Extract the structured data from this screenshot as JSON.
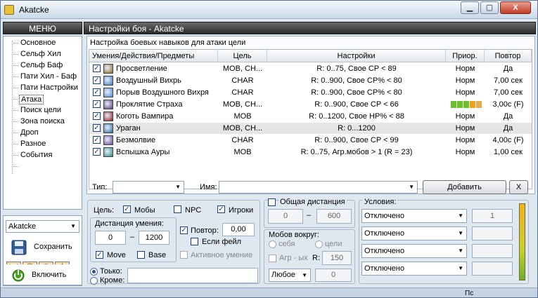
{
  "window": {
    "title": "Akatcke",
    "min_label": "▁",
    "max_label": "▢",
    "close_label": "X"
  },
  "menu": {
    "header": "МЕНЮ",
    "items": [
      "Основное",
      "Сельф Хил",
      "Сельф Баф",
      "Пати Хил - Баф",
      "Пати Настройки",
      "Атака",
      "Поиск цели",
      "Зона поиска",
      "Дроп",
      "Разное",
      "События"
    ],
    "selected": "Атака"
  },
  "profile": {
    "value": "Akatcke",
    "save_label": "Сохранить",
    "enable_label": "Включить"
  },
  "panel": {
    "title": "Настройки боя  -  Akatcke",
    "caption": "Настройка боевых навыков для атаки цели"
  },
  "table": {
    "headers": [
      "Умения/Действия/Предметы",
      "Цель",
      "Настройки",
      "Приор.",
      "Повтор"
    ],
    "rows": [
      {
        "name": "Просветление",
        "target": "MOB, CH...",
        "settings": "R: 0..75,  Свое CP  <  89",
        "prio": "Норм",
        "repeat": "Да",
        "icon": "#8a6a2a"
      },
      {
        "name": "Воздушный Вихрь",
        "target": "CHAR",
        "settings": "R: 0..900,  Свое CP%  <  80",
        "prio": "Норм",
        "repeat": "7,00 сек",
        "icon": "#3a78b8"
      },
      {
        "name": "Порыв Воздушного Вихря",
        "target": "CHAR",
        "settings": "R: 0..900,  Свое CP%  <  80",
        "prio": "Норм",
        "repeat": "7,00 сек",
        "icon": "#4a88c8"
      },
      {
        "name": "Проклятие Страха",
        "target": "MOB, CH...",
        "settings": "R: 0..900,  Свое CP  <  66",
        "prio": "",
        "repeat": "3,00с (F)",
        "icon": "#5a3a6a",
        "prio_level": 0.7
      },
      {
        "name": "Коготь Вампира",
        "target": "MOB",
        "settings": "R: 0..1200,  Свое HP%  <  88",
        "prio": "Норм",
        "repeat": "Да",
        "icon": "#8a2020"
      },
      {
        "name": "Ураган",
        "target": "MOB, CH...",
        "settings": "R: 0...1200",
        "prio": "Норм",
        "repeat": "Да",
        "icon": "#2a6a9a",
        "selected": true
      },
      {
        "name": "Безмолвие",
        "target": "CHAR",
        "settings": "R: 0..900,  Свое CP  <  99",
        "prio": "Норм",
        "repeat": "4,00с (F)",
        "icon": "#6a4a8a"
      },
      {
        "name": "Вспышка Ауры",
        "target": "MOB",
        "settings": "R: 0..75,  Агр.мобов  >  1 (R = 23)",
        "prio": "Норм",
        "repeat": "1,00 сек",
        "icon": "#2a8a7a"
      }
    ]
  },
  "filter": {
    "type_label": "Тип:",
    "name_label": "Имя:",
    "add_label": "Добавить",
    "clear_label": "X"
  },
  "target": {
    "label": "Цель:",
    "mobs": "Мобы",
    "npc": "NPC",
    "players": "Игроки"
  },
  "range": {
    "label": "Дистанция умения:",
    "min": "0",
    "max": "1200",
    "dash": "–",
    "move": "Move",
    "base": "Base"
  },
  "repeat": {
    "label": "Повтор:",
    "value": "0,00",
    "if_fail": "Если фейл",
    "active": "Активное умение"
  },
  "who": {
    "only": "Тоько:",
    "except": "Кроме:"
  },
  "common_distance": {
    "label": "Общая дистанция",
    "min": "0",
    "max": "600",
    "dash": "–"
  },
  "mobs_around": {
    "label": "Мобов вокруг:",
    "self": "себя",
    "target": "цели",
    "aggro": "Агр - ых",
    "r_label": "R:",
    "r_value": "150",
    "any": "Любое",
    "count": "0"
  },
  "conditions": {
    "label": "Условия:",
    "items": [
      {
        "value": "Отключено",
        "n": "1"
      },
      {
        "value": "Отключено",
        "n": ""
      },
      {
        "value": "Отключено",
        "n": ""
      },
      {
        "value": "Отключено",
        "n": ""
      }
    ]
  },
  "status": {
    "text": "Пс"
  },
  "colors": {
    "accent": "#f0a020",
    "progress": "#6ac02a",
    "header_bg": "#333333"
  }
}
